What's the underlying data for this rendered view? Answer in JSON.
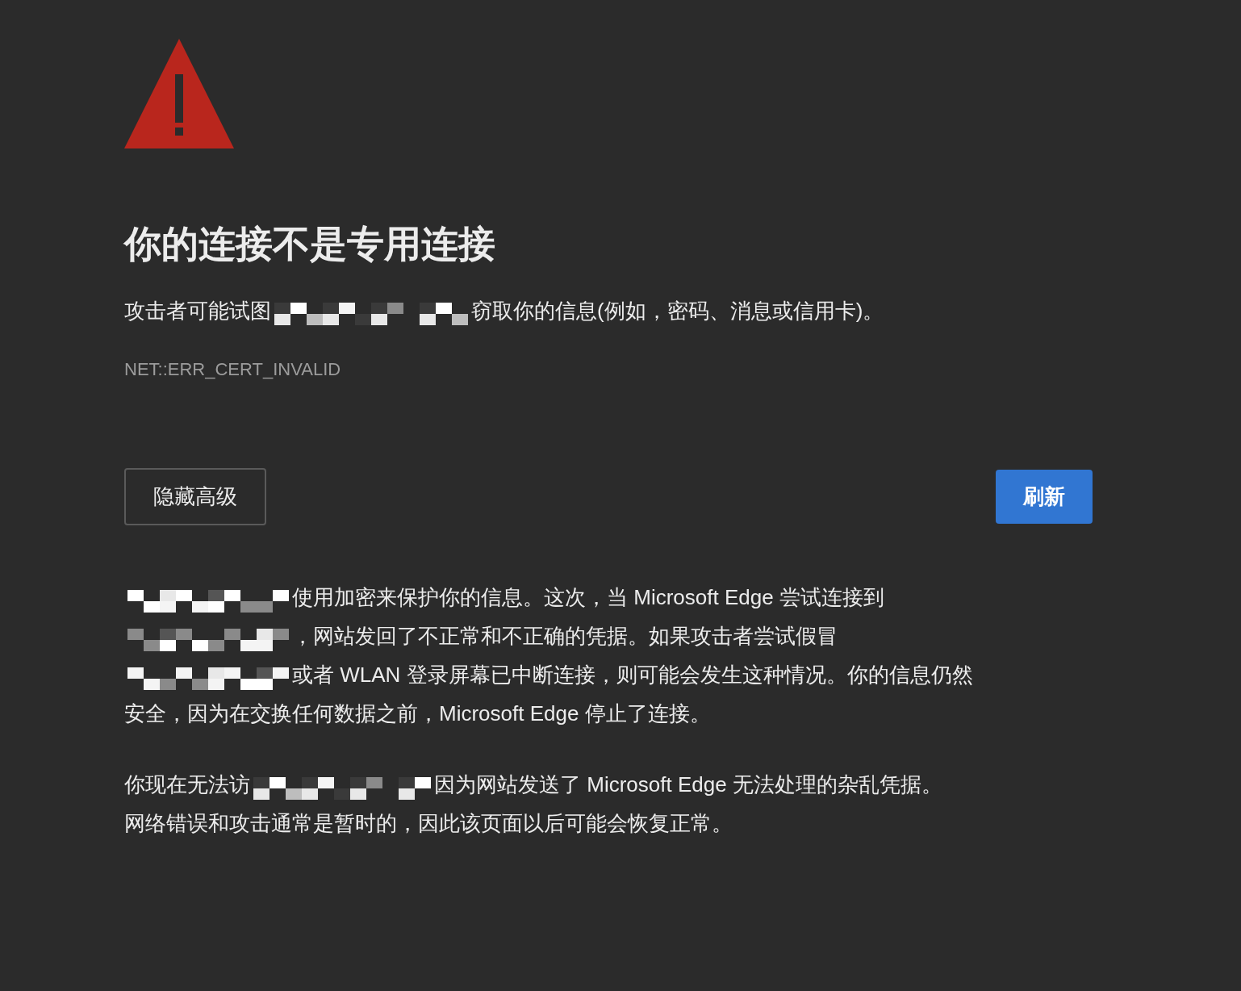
{
  "heading": "你的连接不是专用连接",
  "summary": [
    {
      "kind": "text",
      "text": "攻击者可能试图"
    },
    {
      "kind": "redaction"
    },
    {
      "kind": "text",
      "text": "窃取你的信息(例如，密码、消息或信用卡)。"
    }
  ],
  "error_code": "NET::ERR_CERT_INVALID",
  "buttons": [
    {
      "label": "隐藏高级",
      "kind": "secondary"
    },
    {
      "label": "刷新",
      "kind": "primary"
    }
  ],
  "details": [
    [
      [
        {
          "kind": "redaction"
        },
        {
          "kind": "text",
          "text": "使用加密来保护你的信息。这次，当 Microsoft Edge 尝试连接到"
        }
      ],
      [
        {
          "kind": "redaction"
        },
        {
          "kind": "text",
          "text": "，网站发回了不正常和不正确的凭据。如果攻击者尝试假冒"
        }
      ],
      [
        {
          "kind": "redaction"
        },
        {
          "kind": "text",
          "text": "或者 WLAN 登录屏幕已中断连接，则可能会发生这种情况。你的信息仍然"
        }
      ],
      [
        {
          "kind": "text",
          "text": "安全，因为在交换任何数据之前，Microsoft Edge 停止了连接。"
        }
      ]
    ],
    [
      [
        {
          "kind": "text",
          "text": "你现在无法访"
        },
        {
          "kind": "redaction"
        },
        {
          "kind": "text",
          "text": "因为网站发送了 Microsoft Edge 无法处理的杂乱凭据。"
        }
      ],
      [
        {
          "kind": "text",
          "text": "网络错误和攻击通常是暂时的，因此该页面以后可能会恢复正常。"
        }
      ]
    ]
  ]
}
